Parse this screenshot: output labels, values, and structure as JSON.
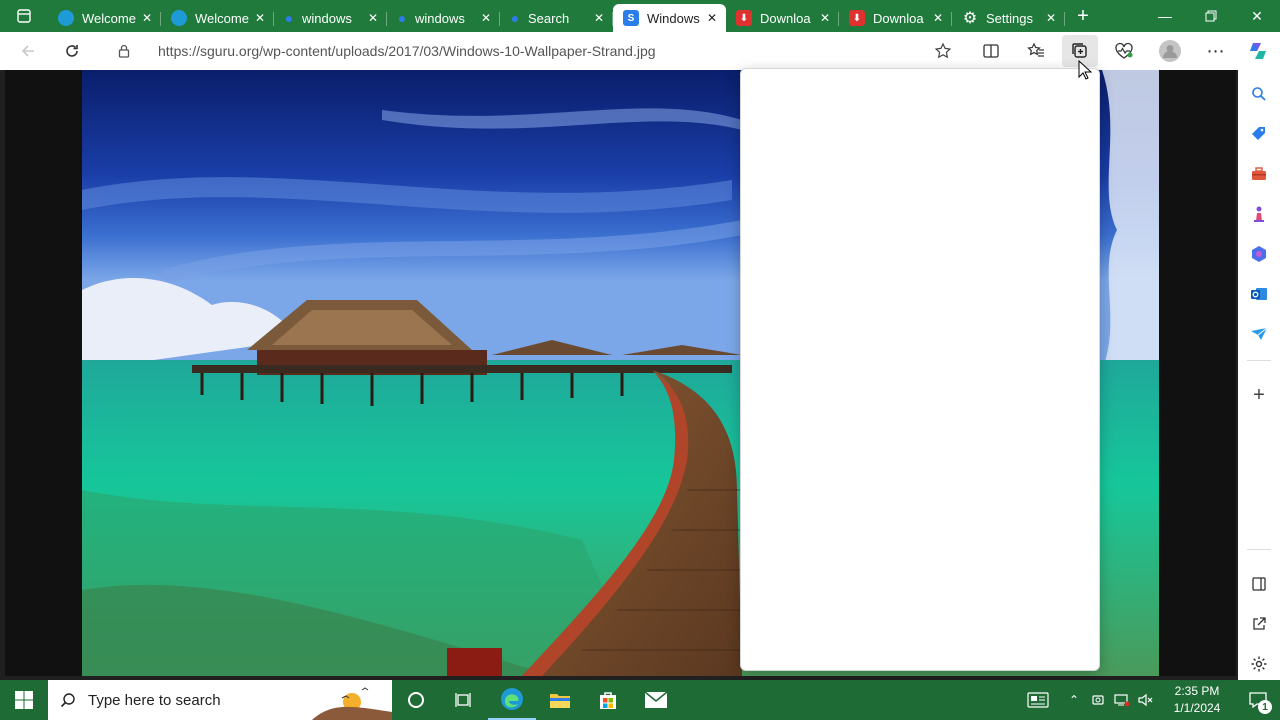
{
  "tabs": [
    {
      "title": "Welcome",
      "favicon": "edge-icon",
      "color": "#1e9ad6"
    },
    {
      "title": "Welcome",
      "favicon": "edge-icon",
      "color": "#1e9ad6"
    },
    {
      "title": "windows",
      "favicon": "search-icon",
      "color": "#2b7de9"
    },
    {
      "title": "windows",
      "favicon": "search-icon",
      "color": "#2b7de9"
    },
    {
      "title": "Search",
      "favicon": "search-icon",
      "color": "#2b7de9"
    },
    {
      "title": "Windows",
      "favicon": "sguru-icon",
      "color": "#2b7de9",
      "active": true
    },
    {
      "title": "Downloa",
      "favicon": "download-icon",
      "color": "#e03131"
    },
    {
      "title": "Downloa",
      "favicon": "download-icon",
      "color": "#e03131"
    },
    {
      "title": "Settings",
      "favicon": "gear-icon",
      "color": "#ffffff"
    }
  ],
  "address": {
    "url": "https://sguru.org/wp-content/uploads/2017/03/Windows-10-Wallpaper-Strand.jpg"
  },
  "taskbar": {
    "search_placeholder": "Type here to search",
    "time": "2:35 PM",
    "date": "1/1/2024",
    "notification_count": "1"
  },
  "colors": {
    "tabstrip": "#1f7a3c",
    "taskbar": "#1f6b36"
  }
}
